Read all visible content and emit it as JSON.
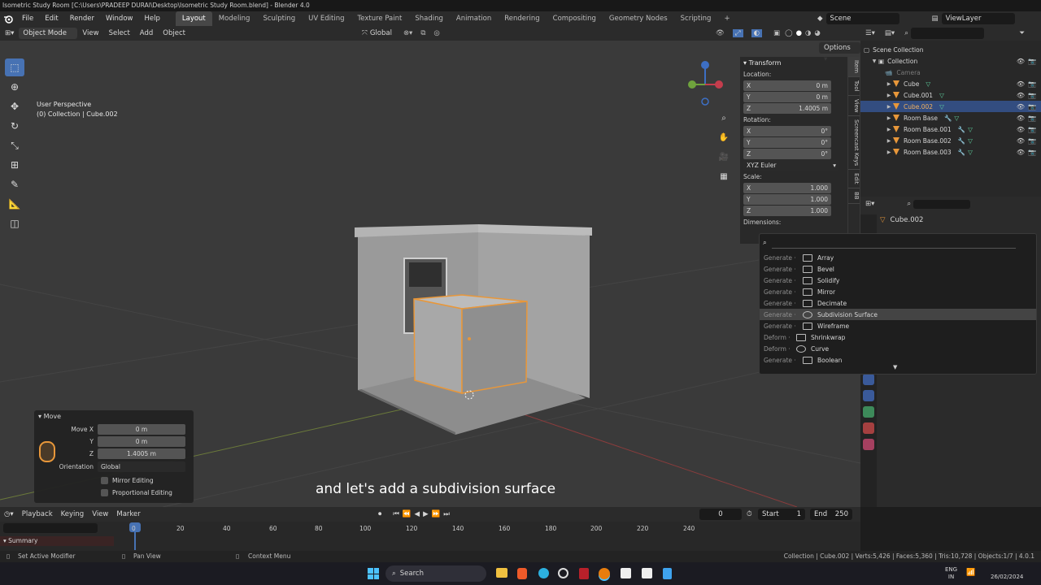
{
  "window_title": "Isometric Study Room [C:\\Users\\PRADEEP DURAI\\Desktop\\Isometric Study Room.blend] - Blender 4.0",
  "menu": [
    "File",
    "Edit",
    "Render",
    "Window",
    "Help"
  ],
  "workspaces": [
    "Layout",
    "Modeling",
    "Sculpting",
    "UV Editing",
    "Texture Paint",
    "Shading",
    "Animation",
    "Rendering",
    "Compositing",
    "Geometry Nodes",
    "Scripting"
  ],
  "scene_name": "Scene",
  "view_layer": "ViewLayer",
  "vp_header": {
    "mode": "Object Mode",
    "menus": [
      "View",
      "Select",
      "Add",
      "Object"
    ],
    "orientation": "Global"
  },
  "overlay": {
    "line1": "User Perspective",
    "line2": "(0) Collection | Cube.002"
  },
  "options_label": "Options",
  "npanel": {
    "tabs": [
      "Item",
      "Tool",
      "View",
      "Screencast Keys",
      "Edit",
      "BB"
    ],
    "title": "Transform",
    "location_label": "Location:",
    "location": [
      {
        "axis": "X",
        "value": "0 m"
      },
      {
        "axis": "Y",
        "value": "0 m"
      },
      {
        "axis": "Z",
        "value": "1.4005 m"
      }
    ],
    "rotation_label": "Rotation:",
    "rotation": [
      {
        "axis": "X",
        "value": "0°"
      },
      {
        "axis": "Y",
        "value": "0°"
      },
      {
        "axis": "Z",
        "value": "0°"
      }
    ],
    "rotation_mode": "XYZ Euler",
    "scale_label": "Scale:",
    "scale": [
      {
        "axis": "X",
        "value": "1.000"
      },
      {
        "axis": "Y",
        "value": "1.000"
      },
      {
        "axis": "Z",
        "value": "1.000"
      }
    ],
    "dimensions_label": "Dimensions:"
  },
  "popup": {
    "items": [
      {
        "cat": "Generate ·",
        "label": "Array"
      },
      {
        "cat": "Generate ·",
        "label": "Bevel"
      },
      {
        "cat": "Generate ·",
        "label": "Solidify"
      },
      {
        "cat": "Generate ·",
        "label": "Mirror"
      },
      {
        "cat": "Generate ·",
        "label": "Decimate"
      },
      {
        "cat": "Generate ·",
        "label": "Subdivision Surface"
      },
      {
        "cat": "Generate ·",
        "label": "Wireframe"
      },
      {
        "cat": "Deform ·",
        "label": "Shrinkwrap"
      },
      {
        "cat": "Deform ·",
        "label": "Curve"
      },
      {
        "cat": "Generate ·",
        "label": "Boolean"
      }
    ]
  },
  "outliner": {
    "root": "Scene Collection",
    "collection": "Collection",
    "rows": [
      "Camera",
      "Cube",
      "Cube.001",
      "Cube.002",
      "Room Base",
      "Room Base.001",
      "Room Base.002",
      "Room Base.003"
    ]
  },
  "properties": {
    "object_name": "Cube.002"
  },
  "move_panel": {
    "title": "Move",
    "rows": [
      {
        "label": "Move X",
        "value": "0 m"
      },
      {
        "label": "Y",
        "value": "0 m"
      },
      {
        "label": "Z",
        "value": "1.4005 m"
      }
    ],
    "orientation_label": "Orientation",
    "orientation_value": "Global",
    "mirror": "Mirror Editing",
    "proportional": "Proportional Editing"
  },
  "subtitle": "and let's add a subdivision surface",
  "timeline": {
    "menus": [
      "Playback",
      "Keying",
      "View",
      "Marker"
    ],
    "current_frame": "0",
    "start_label": "Start",
    "start": "1",
    "end_label": "End",
    "end": "250",
    "ticks": [
      "0",
      "20",
      "40",
      "60",
      "80",
      "100",
      "120",
      "140",
      "160",
      "180",
      "200",
      "220",
      "240"
    ],
    "summary": "Summary"
  },
  "status": {
    "left": "Set Active Modifier",
    "mid": "Pan View",
    "ctx": "Context Menu",
    "right": "Collection | Cube.002 | Verts:5,426 | Faces:5,360 | Tris:10,728 | Objects:1/7 | 4.0.1"
  },
  "taskbar": {
    "search": "Search",
    "lang1": "ENG",
    "lang2": "IN",
    "date": "26/02/2024"
  }
}
